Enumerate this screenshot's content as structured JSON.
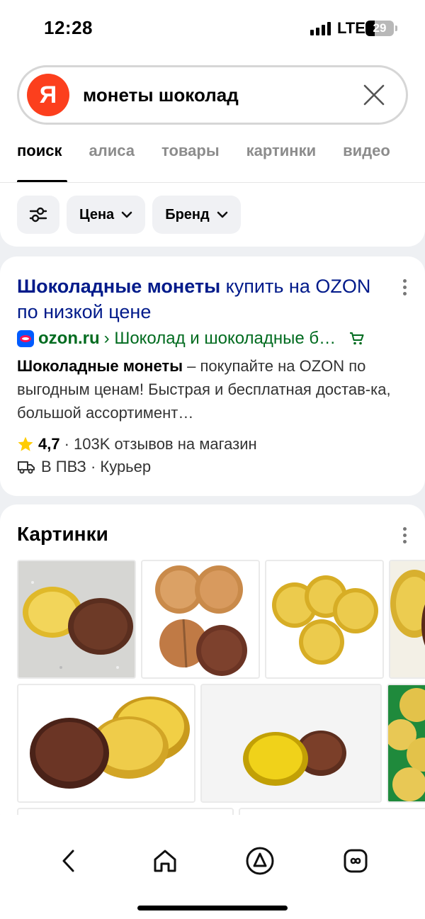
{
  "status_bar": {
    "time": "12:28",
    "network": "LTE",
    "battery": "29"
  },
  "search": {
    "logo": "Я",
    "query": "монеты шоколад"
  },
  "tabs": [
    {
      "label": "поиск",
      "active": true
    },
    {
      "label": "алиса"
    },
    {
      "label": "товары"
    },
    {
      "label": "картинки"
    },
    {
      "label": "видео"
    }
  ],
  "filters": {
    "price": "Цена",
    "brand": "Бренд"
  },
  "result": {
    "title_bold": "Шоколадные монеты",
    "title_rest": " купить на OZON по низкой цене",
    "domain": "ozon.ru",
    "path": " › Шоколад и шоколадные б…",
    "snippet_bold": "Шоколадные монеты",
    "snippet_rest": " – покупайте на OZON по выгодным ценам! Быстрая и бесплатная достав-ка, большой ассортимент…",
    "rating": "4,7",
    "reviews": "· 103K отзывов на магазин",
    "delivery": "В ПВЗ · Курьер"
  },
  "images_section": {
    "title": "Картинки"
  },
  "colors": {
    "link": "#001a8a",
    "source": "#006b1f",
    "yandex_red": "#fc3f1d",
    "star": "#ffcc00"
  }
}
